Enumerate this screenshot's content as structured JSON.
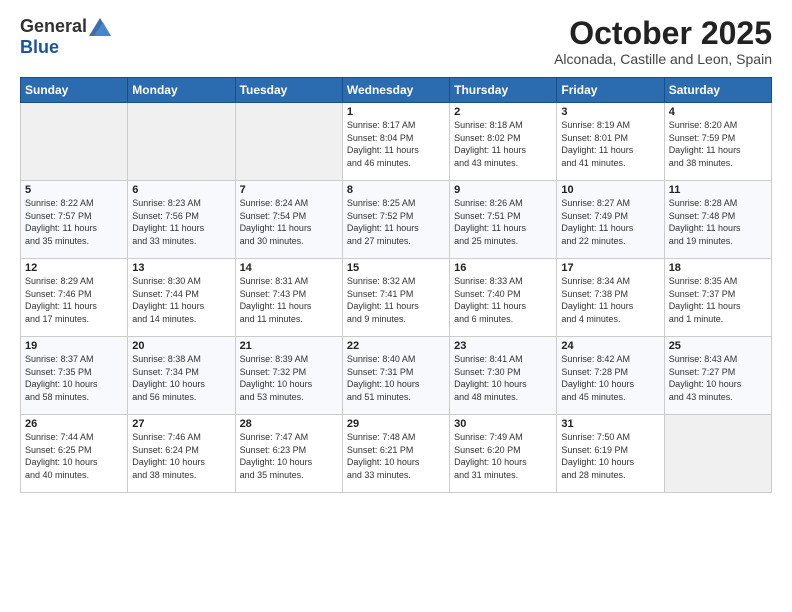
{
  "header": {
    "logo_general": "General",
    "logo_blue": "Blue",
    "month": "October 2025",
    "location": "Alconada, Castille and Leon, Spain"
  },
  "weekdays": [
    "Sunday",
    "Monday",
    "Tuesday",
    "Wednesday",
    "Thursday",
    "Friday",
    "Saturday"
  ],
  "weeks": [
    [
      {
        "day": "",
        "info": ""
      },
      {
        "day": "",
        "info": ""
      },
      {
        "day": "",
        "info": ""
      },
      {
        "day": "1",
        "info": "Sunrise: 8:17 AM\nSunset: 8:04 PM\nDaylight: 11 hours\nand 46 minutes."
      },
      {
        "day": "2",
        "info": "Sunrise: 8:18 AM\nSunset: 8:02 PM\nDaylight: 11 hours\nand 43 minutes."
      },
      {
        "day": "3",
        "info": "Sunrise: 8:19 AM\nSunset: 8:01 PM\nDaylight: 11 hours\nand 41 minutes."
      },
      {
        "day": "4",
        "info": "Sunrise: 8:20 AM\nSunset: 7:59 PM\nDaylight: 11 hours\nand 38 minutes."
      }
    ],
    [
      {
        "day": "5",
        "info": "Sunrise: 8:22 AM\nSunset: 7:57 PM\nDaylight: 11 hours\nand 35 minutes."
      },
      {
        "day": "6",
        "info": "Sunrise: 8:23 AM\nSunset: 7:56 PM\nDaylight: 11 hours\nand 33 minutes."
      },
      {
        "day": "7",
        "info": "Sunrise: 8:24 AM\nSunset: 7:54 PM\nDaylight: 11 hours\nand 30 minutes."
      },
      {
        "day": "8",
        "info": "Sunrise: 8:25 AM\nSunset: 7:52 PM\nDaylight: 11 hours\nand 27 minutes."
      },
      {
        "day": "9",
        "info": "Sunrise: 8:26 AM\nSunset: 7:51 PM\nDaylight: 11 hours\nand 25 minutes."
      },
      {
        "day": "10",
        "info": "Sunrise: 8:27 AM\nSunset: 7:49 PM\nDaylight: 11 hours\nand 22 minutes."
      },
      {
        "day": "11",
        "info": "Sunrise: 8:28 AM\nSunset: 7:48 PM\nDaylight: 11 hours\nand 19 minutes."
      }
    ],
    [
      {
        "day": "12",
        "info": "Sunrise: 8:29 AM\nSunset: 7:46 PM\nDaylight: 11 hours\nand 17 minutes."
      },
      {
        "day": "13",
        "info": "Sunrise: 8:30 AM\nSunset: 7:44 PM\nDaylight: 11 hours\nand 14 minutes."
      },
      {
        "day": "14",
        "info": "Sunrise: 8:31 AM\nSunset: 7:43 PM\nDaylight: 11 hours\nand 11 minutes."
      },
      {
        "day": "15",
        "info": "Sunrise: 8:32 AM\nSunset: 7:41 PM\nDaylight: 11 hours\nand 9 minutes."
      },
      {
        "day": "16",
        "info": "Sunrise: 8:33 AM\nSunset: 7:40 PM\nDaylight: 11 hours\nand 6 minutes."
      },
      {
        "day": "17",
        "info": "Sunrise: 8:34 AM\nSunset: 7:38 PM\nDaylight: 11 hours\nand 4 minutes."
      },
      {
        "day": "18",
        "info": "Sunrise: 8:35 AM\nSunset: 7:37 PM\nDaylight: 11 hours\nand 1 minute."
      }
    ],
    [
      {
        "day": "19",
        "info": "Sunrise: 8:37 AM\nSunset: 7:35 PM\nDaylight: 10 hours\nand 58 minutes."
      },
      {
        "day": "20",
        "info": "Sunrise: 8:38 AM\nSunset: 7:34 PM\nDaylight: 10 hours\nand 56 minutes."
      },
      {
        "day": "21",
        "info": "Sunrise: 8:39 AM\nSunset: 7:32 PM\nDaylight: 10 hours\nand 53 minutes."
      },
      {
        "day": "22",
        "info": "Sunrise: 8:40 AM\nSunset: 7:31 PM\nDaylight: 10 hours\nand 51 minutes."
      },
      {
        "day": "23",
        "info": "Sunrise: 8:41 AM\nSunset: 7:30 PM\nDaylight: 10 hours\nand 48 minutes."
      },
      {
        "day": "24",
        "info": "Sunrise: 8:42 AM\nSunset: 7:28 PM\nDaylight: 10 hours\nand 45 minutes."
      },
      {
        "day": "25",
        "info": "Sunrise: 8:43 AM\nSunset: 7:27 PM\nDaylight: 10 hours\nand 43 minutes."
      }
    ],
    [
      {
        "day": "26",
        "info": "Sunrise: 7:44 AM\nSunset: 6:25 PM\nDaylight: 10 hours\nand 40 minutes."
      },
      {
        "day": "27",
        "info": "Sunrise: 7:46 AM\nSunset: 6:24 PM\nDaylight: 10 hours\nand 38 minutes."
      },
      {
        "day": "28",
        "info": "Sunrise: 7:47 AM\nSunset: 6:23 PM\nDaylight: 10 hours\nand 35 minutes."
      },
      {
        "day": "29",
        "info": "Sunrise: 7:48 AM\nSunset: 6:21 PM\nDaylight: 10 hours\nand 33 minutes."
      },
      {
        "day": "30",
        "info": "Sunrise: 7:49 AM\nSunset: 6:20 PM\nDaylight: 10 hours\nand 31 minutes."
      },
      {
        "day": "31",
        "info": "Sunrise: 7:50 AM\nSunset: 6:19 PM\nDaylight: 10 hours\nand 28 minutes."
      },
      {
        "day": "",
        "info": ""
      }
    ]
  ],
  "colors": {
    "header_bg": "#2b6cb0",
    "header_text": "#ffffff",
    "logo_blue": "#1a56a0"
  }
}
